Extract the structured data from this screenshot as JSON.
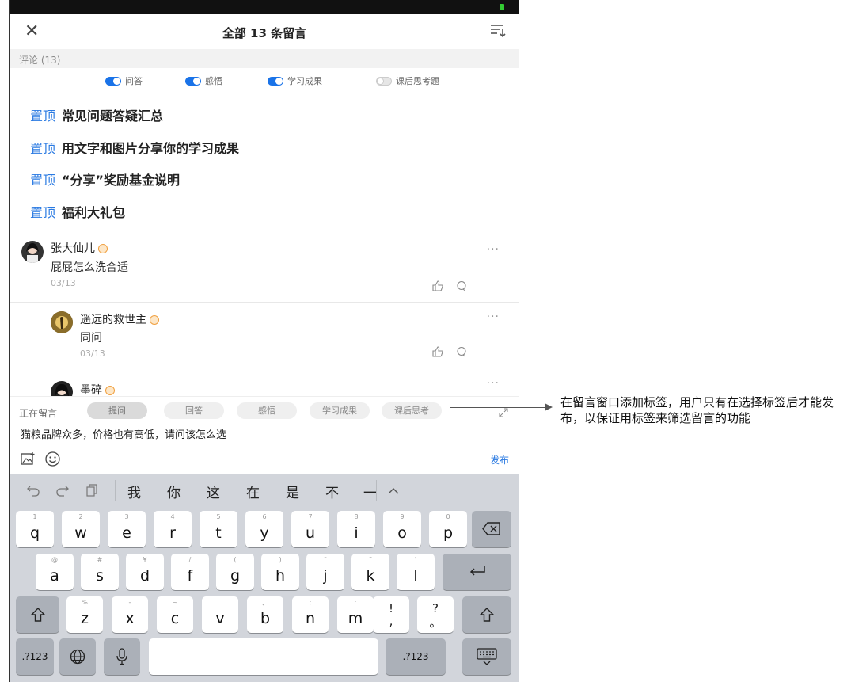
{
  "header": {
    "title": "全部 13 条留言"
  },
  "section": {
    "label": "评论 (13)"
  },
  "toggles": [
    {
      "label": "问答",
      "on": true
    },
    {
      "label": "感悟",
      "on": true
    },
    {
      "label": "学习成果",
      "on": true
    },
    {
      "label": "课后思考题",
      "on": false
    }
  ],
  "pinned": {
    "tag": "置顶",
    "items": [
      "常见问题答疑汇总",
      "用文字和图片分享你的学习成果",
      "“分享”奖励基金说明",
      "福利大礼包"
    ]
  },
  "comments": [
    {
      "name": "张大仙儿",
      "text": "屁屁怎么洗合适",
      "date": "03/13"
    },
    {
      "name": "遥远的救世主",
      "text": "同问",
      "date": "03/13"
    },
    {
      "name": "墨碎"
    }
  ],
  "compose": {
    "label": "正在留言",
    "chips": [
      "提问",
      "回答",
      "感悟",
      "学习成果",
      "课后思考"
    ],
    "text": "猫粮品牌众多，价格也有高低，请问该怎么选",
    "publish": "发布"
  },
  "keyboard": {
    "candidates": [
      "我",
      "你",
      "这",
      "在",
      "是",
      "不",
      "一"
    ],
    "row1": [
      [
        "1",
        "q"
      ],
      [
        "2",
        "w"
      ],
      [
        "3",
        "e"
      ],
      [
        "4",
        "r"
      ],
      [
        "5",
        "t"
      ],
      [
        "6",
        "y"
      ],
      [
        "7",
        "u"
      ],
      [
        "8",
        "i"
      ],
      [
        "9",
        "o"
      ],
      [
        "0",
        "p"
      ]
    ],
    "row2": [
      [
        "@",
        "a"
      ],
      [
        "#",
        "s"
      ],
      [
        "¥",
        "d"
      ],
      [
        "/",
        "f"
      ],
      [
        "(",
        "g"
      ],
      [
        ")",
        "h"
      ],
      [
        "“",
        "j"
      ],
      [
        "”",
        "k"
      ],
      [
        "'",
        "l"
      ]
    ],
    "row3": [
      [
        "%",
        "z"
      ],
      [
        "-",
        "x"
      ],
      [
        "~",
        "c"
      ],
      [
        "…",
        "v"
      ],
      [
        "、",
        "b"
      ],
      [
        ";",
        "n"
      ],
      [
        ":",
        "m"
      ]
    ],
    "punct": [
      [
        "!",
        ","
      ],
      [
        "?",
        "。"
      ]
    ],
    "num_label": ".?123"
  },
  "annotation": {
    "text": "在留言窗口添加标签，用户只有在选择标签后才能发布，以保证用标签来筛选留言的功能"
  },
  "colors": {
    "accent": "#2a7ae2",
    "toggle_on": "#1a73e8",
    "keyboard_bg": "#d2d5db"
  }
}
